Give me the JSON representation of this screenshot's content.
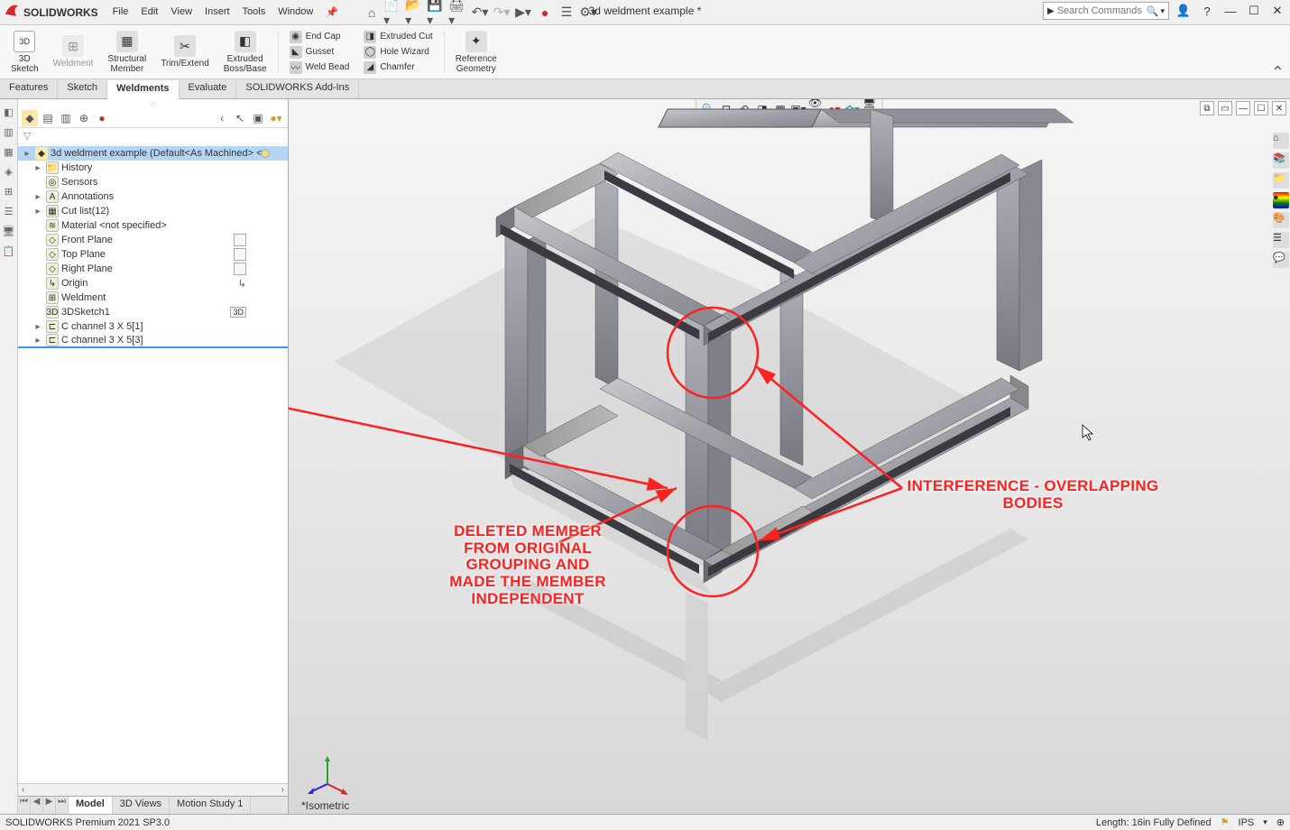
{
  "app": {
    "logo_text": "SOLIDWORKS",
    "title": "3d weldment example *"
  },
  "menu": [
    "File",
    "Edit",
    "View",
    "Insert",
    "Tools",
    "Window"
  ],
  "search": {
    "placeholder": "Search Commands"
  },
  "ribbon": {
    "large": [
      {
        "label": "3D\nSketch",
        "name": "3d-sketch"
      },
      {
        "label": "Weldment",
        "name": "weldment",
        "disabled": true
      },
      {
        "label": "Structural\nMember",
        "name": "structural-member"
      },
      {
        "label": "Trim/Extend",
        "name": "trim-extend"
      },
      {
        "label": "Extruded\nBoss/Base",
        "name": "extruded-boss"
      }
    ],
    "small1": [
      {
        "label": "End Cap",
        "name": "end-cap"
      },
      {
        "label": "Gusset",
        "name": "gusset"
      },
      {
        "label": "Weld Bead",
        "name": "weld-bead"
      }
    ],
    "small2": [
      {
        "label": "Extruded Cut",
        "name": "extruded-cut"
      },
      {
        "label": "Hole Wizard",
        "name": "hole-wizard"
      },
      {
        "label": "Chamfer",
        "name": "chamfer"
      }
    ],
    "large2": [
      {
        "label": "Reference\nGeometry",
        "name": "ref-geom"
      }
    ]
  },
  "tabs": [
    "Features",
    "Sketch",
    "Weldments",
    "Evaluate",
    "SOLIDWORKS Add-Ins"
  ],
  "active_tab": "Weldments",
  "tree": {
    "root": "3d weldment example  (Default<As Machined> <<",
    "items": [
      {
        "label": "History",
        "icon": "📁",
        "expand": true
      },
      {
        "label": "Sensors",
        "icon": "◎"
      },
      {
        "label": "Annotations",
        "icon": "A",
        "expand": true
      },
      {
        "label": "Cut list(12)",
        "icon": "▦",
        "expand": true
      },
      {
        "label": "Material <not specified>",
        "icon": "≋"
      },
      {
        "label": "Front Plane",
        "icon": "◇",
        "annot": true
      },
      {
        "label": "Top Plane",
        "icon": "◇",
        "annot": true
      },
      {
        "label": "Right Plane",
        "icon": "◇",
        "annot": true
      },
      {
        "label": "Origin",
        "icon": "↳",
        "annot_origin": true
      },
      {
        "label": "Weldment",
        "icon": "⊞"
      },
      {
        "label": "3DSketch1",
        "icon": "3D",
        "annot_3d": true
      },
      {
        "label": "C channel 3 X 5[1]",
        "icon": "⊏",
        "expand": true
      },
      {
        "label": "C channel 3 X 5[3]",
        "icon": "⊏",
        "expand": true,
        "underline": true
      }
    ]
  },
  "bottom_tabs": [
    "Model",
    "3D Views",
    "Motion Study 1"
  ],
  "active_bottom_tab": "Model",
  "view_label": "*Isometric",
  "status": {
    "left": "SOLIDWORKS Premium 2021 SP3.0",
    "right_length": "Length: 16in  Fully Defined",
    "right_units": "IPS"
  },
  "annotations": {
    "left_text": "DELETED MEMBER\nFROM ORIGINAL\nGROUPING AND\nMADE THE MEMBER\nINDEPENDENT",
    "right_text": "INTERFERENCE - OVERLAPPING\nBODIES"
  }
}
